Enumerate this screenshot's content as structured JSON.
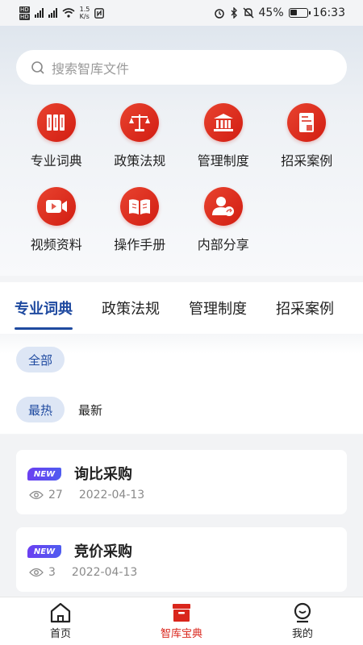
{
  "status": {
    "net_speed": "1.5",
    "net_unit": "K/s",
    "battery": "45%",
    "battery_level": 0.45,
    "time": "16:33"
  },
  "search": {
    "placeholder": "搜索智库文件"
  },
  "categories": [
    {
      "label": "专业词典",
      "icon": "books-icon"
    },
    {
      "label": "政策法规",
      "icon": "scales-icon"
    },
    {
      "label": "管理制度",
      "icon": "institution-icon"
    },
    {
      "label": "招采案例",
      "icon": "document-icon"
    },
    {
      "label": "视频资料",
      "icon": "video-icon"
    },
    {
      "label": "操作手册",
      "icon": "open-book-icon"
    },
    {
      "label": "内部分享",
      "icon": "user-share-icon"
    }
  ],
  "tabs": [
    "专业词典",
    "政策法规",
    "管理制度",
    "招采案例"
  ],
  "active_tab": 0,
  "filters": {
    "all": "全部",
    "hot": "最热",
    "new": "最新"
  },
  "items": [
    {
      "badge": "NEW",
      "title": "询比采购",
      "views": "27",
      "date": "2022-04-13"
    },
    {
      "badge": "NEW",
      "title": "竞价采购",
      "views": "3",
      "date": "2022-04-13"
    }
  ],
  "nav": [
    {
      "label": "首页",
      "icon": "home-icon"
    },
    {
      "label": "智库宝典",
      "icon": "treasure-box-icon"
    },
    {
      "label": "我的",
      "icon": "profile-icon"
    }
  ],
  "colors": {
    "accent_red": "#d9261c",
    "accent_blue": "#1f4aa0",
    "badge_purple": "#6b3ff1"
  }
}
